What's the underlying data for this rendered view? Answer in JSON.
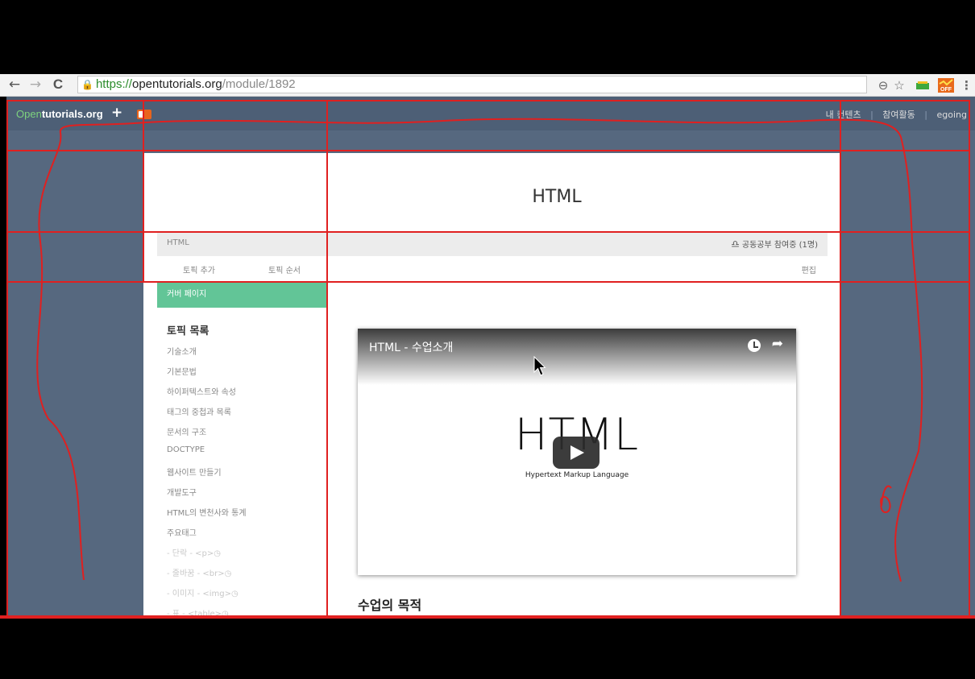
{
  "browser": {
    "back_icon": "←",
    "forward_icon": "→",
    "reload_icon": "C",
    "url_scheme": "https://",
    "url_host": "opentutorials.org",
    "url_path": "/module/1892",
    "zoom_icon": "⊖",
    "star_icon": "☆"
  },
  "site": {
    "logo_open": "Open",
    "logo_rest": "tutorials.org",
    "add_icon": "+",
    "nav": [
      "내 컨텐츠",
      "참여활동",
      "egoing"
    ]
  },
  "page": {
    "title": "HTML",
    "topic_name": "HTML",
    "study_icon": "♎",
    "study_text": "공동공부 참여중 (1명)",
    "actions": {
      "add": "토픽 추가",
      "order": "토픽 순서",
      "edit": "편집"
    },
    "cover": "커버 페이지",
    "toc_heading": "토픽 목록",
    "toc_items": [
      "기술소개",
      "기본문법",
      "하이퍼텍스트와 속성",
      "태그의 중첩과 목록",
      "문서의 구조",
      "DOCTYPE",
      "웹사이트 만들기",
      "개발도구",
      "HTML의 변천사와 통계",
      "주요태그"
    ],
    "toc_sub": [
      "- 단락 - <p>◷",
      "- 줄바꿈 - <br>◷",
      "- 이미지 - <img>◷",
      "- 표 - <table>◷"
    ],
    "section_title": "수업의 목적"
  },
  "video": {
    "title": "HTML - 수업소개",
    "big_word": "HTML",
    "sub_word": "Hypertext Markup Language",
    "share_icon": "➦"
  },
  "annotation_mark": "6",
  "colors": {
    "accent_green": "#62c597",
    "nav_bg": "#56687f",
    "drawing_red": "#e02020"
  }
}
